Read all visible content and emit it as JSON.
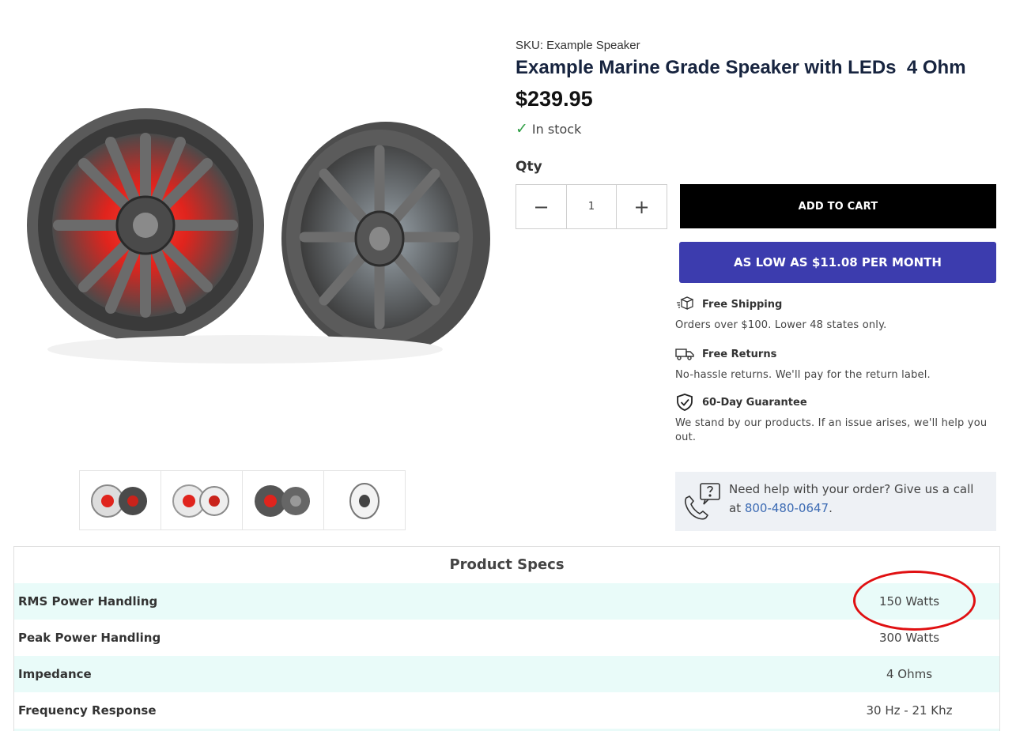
{
  "product": {
    "sku": "SKU: Example Speaker",
    "title": "Example Marine Grade Speaker with LEDs  4 Ohm",
    "price": "$239.95",
    "stock": "In stock"
  },
  "purchase": {
    "qty_label": "Qty",
    "qty_value": "1",
    "add_to_cart": "ADD TO CART",
    "finance": "AS LOW AS $11.08 PER MONTH"
  },
  "perks": [
    {
      "title": "Free Shipping",
      "desc": "Orders over $100. Lower 48 states only.",
      "icon": "box-icon"
    },
    {
      "title": "Free Returns",
      "desc": "No-hassle returns. We'll pay for the return label.",
      "icon": "truck-icon"
    },
    {
      "title": "60-Day Guarantee",
      "desc": "We stand by our products. If an issue arises, we'll help you out.",
      "icon": "shield-check-icon"
    }
  ],
  "help": {
    "text": "Need help with your order? Give us a call at ",
    "phone": "800-480-0647",
    "after": "."
  },
  "specs": {
    "title": "Product Specs",
    "rows": [
      {
        "label": "RMS Power Handling",
        "value": "150 Watts"
      },
      {
        "label": "Peak Power Handling",
        "value": "300 Watts"
      },
      {
        "label": "Impedance",
        "value": "4 Ohms"
      },
      {
        "label": "Frequency Response",
        "value": "30 Hz - 21 Khz"
      }
    ]
  },
  "colors": {
    "title": "#17243f",
    "finance_button": "#3c3cae",
    "in_stock_check": "#2e9e44",
    "spec_row_alt": "#e9fbf9",
    "annotation_circle": "#e01012",
    "phone_link": "#3b6ab3"
  }
}
